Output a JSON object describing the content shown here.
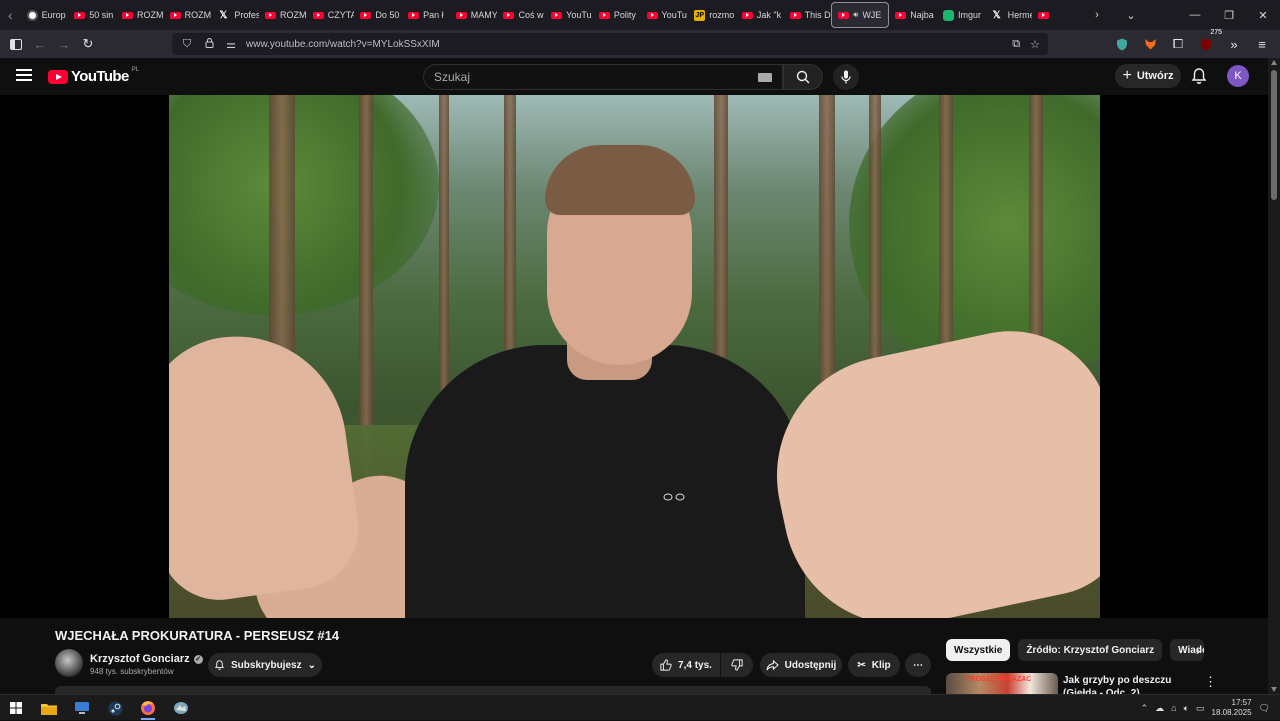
{
  "browser": {
    "tabs": [
      {
        "label": "Europ",
        "icon": "globe-icon"
      },
      {
        "label": "50 sin",
        "icon": "youtube-icon"
      },
      {
        "label": "ROZM",
        "icon": "youtube-icon"
      },
      {
        "label": "ROZM",
        "icon": "youtube-icon"
      },
      {
        "label": "Profes",
        "icon": "x-icon"
      },
      {
        "label": "ROZM",
        "icon": "youtube-icon"
      },
      {
        "label": "CZYTA",
        "icon": "youtube-icon"
      },
      {
        "label": "Do 50",
        "icon": "youtube-icon"
      },
      {
        "label": "Pan ł",
        "icon": "youtube-icon"
      },
      {
        "label": "MAMY",
        "icon": "youtube-icon"
      },
      {
        "label": "Coś w",
        "icon": "youtube-icon"
      },
      {
        "label": "YouTu",
        "icon": "youtube-icon"
      },
      {
        "label": "Polity",
        "icon": "youtube-icon"
      },
      {
        "label": "YouTu",
        "icon": "youtube-icon"
      },
      {
        "label": "rozmo",
        "icon": "jp-icon"
      },
      {
        "label": "Jak \"k",
        "icon": "youtube-icon"
      },
      {
        "label": "This D",
        "icon": "youtube-icon"
      },
      {
        "label": "WJE",
        "icon": "youtube-icon",
        "active": true
      },
      {
        "label": "Najba",
        "icon": "youtube-icon"
      },
      {
        "label": "Imgur",
        "icon": "imgur-icon"
      },
      {
        "label": "Herme",
        "icon": "x-icon"
      },
      {
        "label": "",
        "icon": "youtube-icon"
      }
    ],
    "url": "www.youtube.com/watch?v=MYLokSSxXIM",
    "extensions_badge": "275"
  },
  "youtube": {
    "logo_text": "YouTube",
    "region": "PL",
    "search_placeholder": "Szukaj",
    "create_label": "Utwórz",
    "avatar_letter": "K"
  },
  "video": {
    "title": "WJECHAŁA PROKURATURA - PERSEUSZ #14",
    "channel": "Krzysztof Gonciarz",
    "subscribers": "948 tys. subskrybentów",
    "subscribe_label": "Subskrybujesz",
    "likes": "7,4 tys.",
    "share_label": "Udostępnij",
    "clip_label": "Klip"
  },
  "recommendations": {
    "chips": [
      "Wszystkie",
      "Źródło: Krzysztof Gonciarz",
      "Wiado"
    ],
    "first_title": "Jak grzyby po deszczu (Giełda - Odc. 2)",
    "thumb_text": "PROSZĘ POKAZAĆ"
  },
  "taskbar": {
    "time": "17:57",
    "date": "18.08.2025"
  },
  "colors": {
    "youtube_red": "#ff0033",
    "background": "#0f0f0f",
    "avatar": "#7e57c2"
  }
}
